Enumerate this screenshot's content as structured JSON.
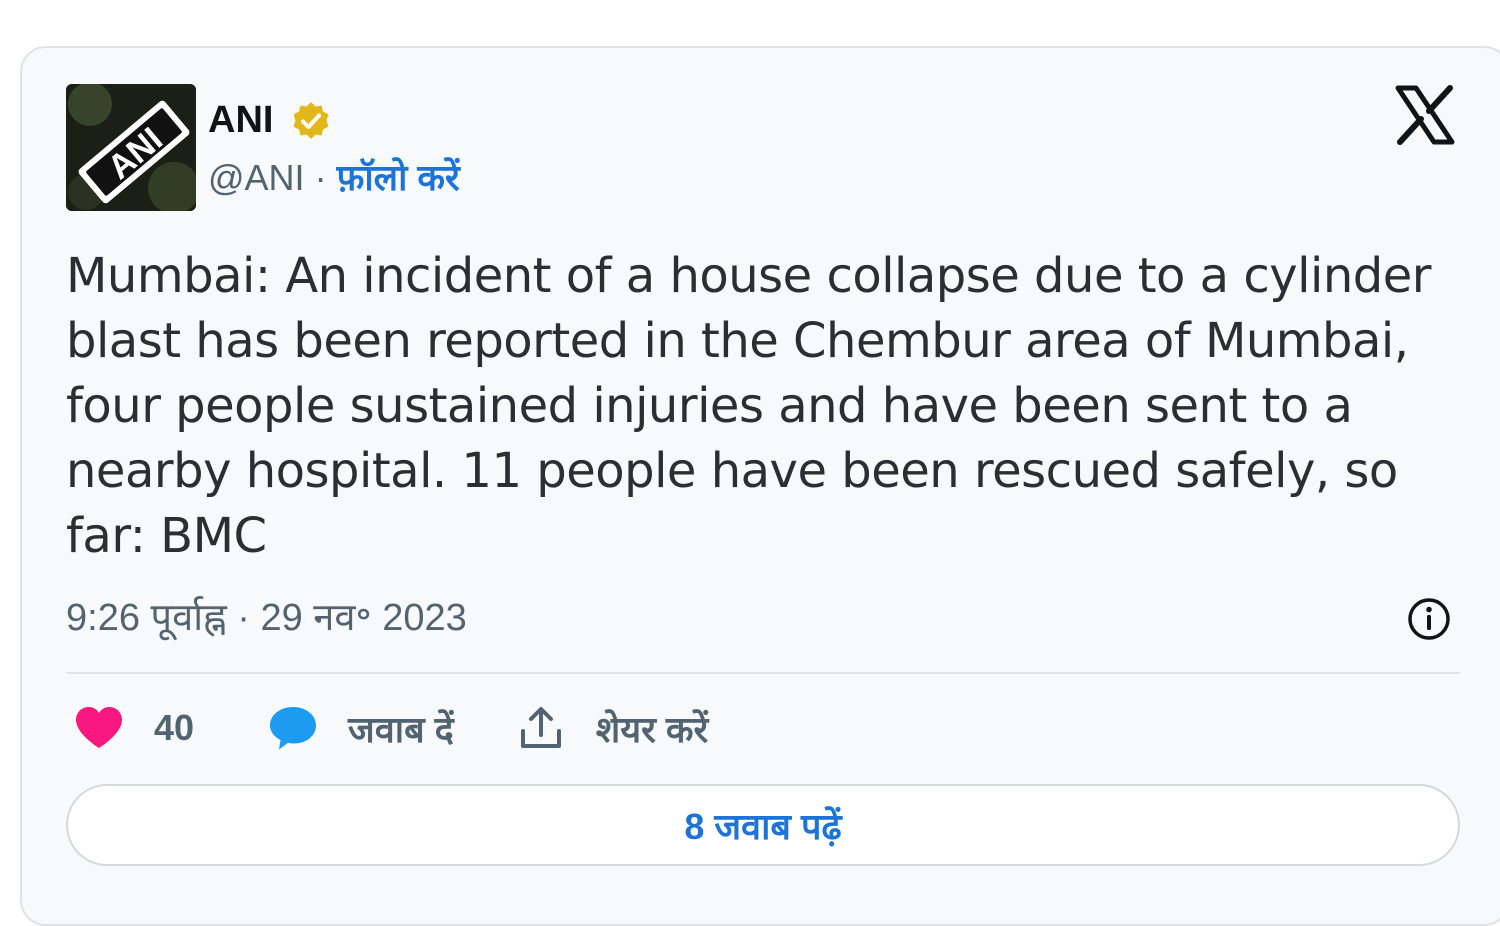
{
  "author": {
    "name": "ANI",
    "handle": "@ANI",
    "separator": "·",
    "follow_label": "फ़ॉलो करें",
    "avatar_text": "ANI",
    "verified": true
  },
  "platform": {
    "logo": "x-logo-icon"
  },
  "tweet": {
    "text": "Mumbai: An incident of a house collapse due to a cylinder blast has been reported in the Chembur area of Mumbai, four people sustained injuries and have been sent to a nearby hospital. 11 people have been rescued safely, so far: BMC",
    "timestamp": "9:26 पूर्वाह्न · 29 नव॰ 2023"
  },
  "actions": {
    "like_count": "40",
    "reply_label": "जवाब दें",
    "share_label": "शेयर करें"
  },
  "read_replies_label": "8 जवाब पढ़ें",
  "colors": {
    "accent": "#1d74d6",
    "like": "#f91880",
    "reply": "#1d9bf0",
    "verified_badge": "#e2b719",
    "card_background": "#f8f9fa"
  }
}
